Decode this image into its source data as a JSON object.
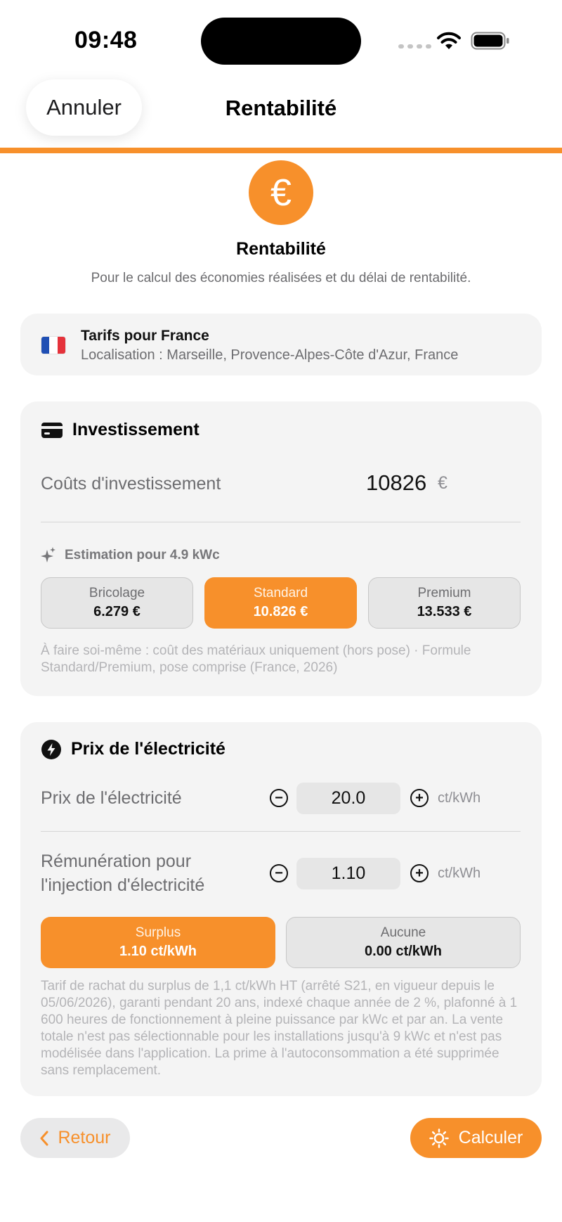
{
  "status_bar": {
    "time": "09:48"
  },
  "nav": {
    "cancel_label": "Annuler",
    "title": "Rentabilité"
  },
  "header": {
    "title": "Rentabilité",
    "subtitle": "Pour le calcul des économies réalisées et du délai de rentabilité."
  },
  "country": {
    "title": "Tarifs pour France",
    "location": "Localisation : Marseille, Provence-Alpes-Côte d'Azur, France"
  },
  "investment": {
    "heading": "Investissement",
    "cost_label": "Coûts d'investissement",
    "cost_value": "10826",
    "cost_unit": "€",
    "estimation_label": "Estimation pour 4.9 kWc",
    "options": [
      {
        "name": "Bricolage",
        "price": "6.279 €",
        "selected": false
      },
      {
        "name": "Standard",
        "price": "10.826 €",
        "selected": true
      },
      {
        "name": "Premium",
        "price": "13.533 €",
        "selected": false
      }
    ],
    "note": "À faire soi-même : coût des matériaux uniquement (hors pose) · Formule Standard/Premium, pose comprise (France, 2026)"
  },
  "electricity": {
    "heading": "Prix de l'électricité",
    "price_label": "Prix de l'électricité",
    "price_value": "20.0",
    "price_unit": "ct/kWh",
    "feedin_label": "Rémunération pour l'injection d'électricité",
    "feedin_value": "1.10",
    "feedin_unit": "ct/kWh",
    "options": [
      {
        "name": "Surplus",
        "price": "1.10 ct/kWh",
        "selected": true
      },
      {
        "name": "Aucune",
        "price": "0.00 ct/kWh",
        "selected": false
      }
    ],
    "note": "Tarif de rachat du surplus de 1,1 ct/kWh HT (arrêté S21, en vigueur depuis le 05/06/2026), garanti pendant 20 ans, indexé chaque année de 2 %, plafonné à 1 600 heures de fonctionnement à pleine puissance par kWc et par an. La vente totale n'est pas sélectionnable pour les installations jusqu'à 9 kWc et n'est pas modélisée dans l'application. La prime à l'autoconsommation a été supprimée sans remplacement."
  },
  "footer": {
    "back_label": "Retour",
    "calc_label": "Calculer"
  },
  "colors": {
    "accent": "#f7902b",
    "card_bg": "#f4f4f4"
  },
  "icons": [
    "wifi-icon",
    "battery-icon",
    "euro-icon",
    "france-flag-icon",
    "credit-card-icon",
    "sparkles-icon",
    "bolt-icon",
    "minus-icon",
    "plus-icon",
    "chevron-left-icon",
    "sun-icon"
  ]
}
